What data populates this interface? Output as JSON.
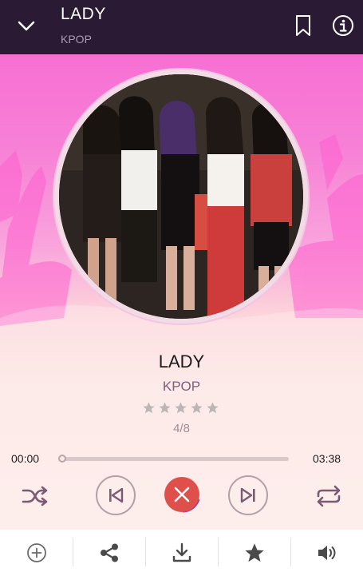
{
  "header": {
    "title": "LADY",
    "subtitle": "KPOP",
    "icons": [
      "chevron-down-icon",
      "bookmark-icon",
      "info-icon"
    ]
  },
  "now_playing": {
    "title": "LADY",
    "artist": "KPOP",
    "rating": 0,
    "rating_max": 5,
    "track_position": "4/8"
  },
  "player": {
    "current_time": "00:00",
    "total_time": "03:38",
    "progress": 0.0,
    "controls": [
      "shuffle-icon",
      "previous-icon",
      "stop-icon",
      "next-icon",
      "repeat-icon"
    ]
  },
  "bottom_bar": {
    "items": [
      "add-to-playlist-icon",
      "share-icon",
      "download-icon",
      "favorite-star-icon",
      "volume-icon"
    ]
  },
  "colors": {
    "header_bg": "#2b1a33",
    "accent": "#8a3fa0",
    "stop_button": "#e0504a"
  }
}
